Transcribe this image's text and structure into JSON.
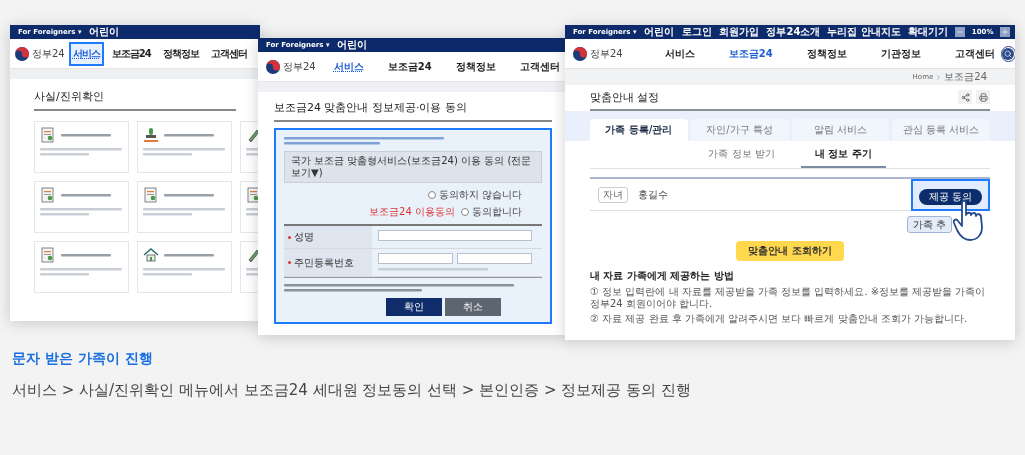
{
  "service_screen": {
    "top_bar": [
      "For Foreigners ▾",
      "어린이"
    ],
    "logo": "정부24",
    "nav": [
      {
        "label": "서비스",
        "selected": true
      },
      {
        "label": "보조금24",
        "selected": false
      },
      {
        "label": "정책정보",
        "selected": false
      },
      {
        "label": "고객센터",
        "selected": false
      }
    ],
    "section_title": "사실/진위확인",
    "cards": [
      {
        "kind": "document"
      },
      {
        "kind": "stamp"
      },
      {
        "kind": "pen"
      },
      {
        "kind": "document"
      },
      {
        "kind": "document"
      },
      {
        "kind": "document"
      },
      {
        "kind": "document"
      },
      {
        "kind": "house"
      },
      {
        "kind": "pen"
      }
    ]
  },
  "consent_screen": {
    "top_bar": [
      "For Foreigners ▾",
      "어린이"
    ],
    "logo": "정부24",
    "nav": [
      {
        "label": "서비스",
        "selected": true
      },
      {
        "label": "보조금24",
        "selected": false
      },
      {
        "label": "정책정보",
        "selected": false
      },
      {
        "label": "고객센터",
        "selected": false
      }
    ],
    "title": "보조금24 맞춤안내 정보제공·이용 동의",
    "consent_bar": "국가 보조금 맞춤형서비스(보조금24) 이용 동의 (전문보기▼)",
    "consent_label": "보조금24 이용동의",
    "options": [
      {
        "label": "동의하지 않습니다",
        "selected": false
      },
      {
        "label": "동의합니다",
        "selected": false
      }
    ],
    "fields": [
      {
        "label": "성명",
        "kind": "single"
      },
      {
        "label": "주민등록번호",
        "kind": "split"
      }
    ],
    "buttons": [
      {
        "label": "확인",
        "kind": "primary"
      },
      {
        "label": "취소",
        "kind": "secondary"
      }
    ]
  },
  "settings_screen": {
    "top_bar": {
      "left": [
        "For Foreigners ▾",
        "어린이"
      ],
      "right": [
        "로그인",
        "회원가입",
        "정부24소개",
        "누리집 안내지도",
        "확대기기"
      ],
      "zoom": "100%"
    },
    "logo": "정부24",
    "nav": [
      {
        "label": "서비스",
        "selected": false
      },
      {
        "label": "보조금24",
        "selected": true
      },
      {
        "label": "정책정보",
        "selected": false
      },
      {
        "label": "기관정보",
        "selected": false
      },
      {
        "label": "고객센터",
        "selected": false
      }
    ],
    "breadcrumb": [
      "Home",
      "보조금24"
    ],
    "title": "맞춤안내 설정",
    "tabs": [
      {
        "label": "가족 등록/관리",
        "selected": true
      },
      {
        "label": "자인/가구 특성",
        "selected": false
      },
      {
        "label": "알림 서비스",
        "selected": false
      },
      {
        "label": "관심 등록 서비스",
        "selected": false
      }
    ],
    "subtabs": [
      {
        "label": "가족 정보 받기",
        "selected": false
      },
      {
        "label": "내 정보 주기",
        "selected": true
      }
    ],
    "family_row": {
      "relation": "자녀",
      "name": "홍길수",
      "button": "제공 동의"
    },
    "add_button": "가족 추",
    "lookup_button": "맞춤안내 조회하기",
    "guide": {
      "heading": "내 자료 가족에게 제공하는 방법",
      "notes": [
        "① 정보 입력란에 내 자료를 제공받을 가족 정보를 입력하세요. ※정보를 제공받을 가족이 정부24 회원이어야 합니다.",
        "② 자료 제공 완료 후 가족에게 알려주시면 보다 빠르게 맞춤안내 조회가 가능합니다."
      ]
    }
  },
  "caption": {
    "title": "문자 받은 가족이 진행",
    "steps": "서비스 > 사실/진위확인 메뉴에서 보조금24 세대원 정보동의 선택 > 본인인증 > 정보제공 동의 진행"
  }
}
